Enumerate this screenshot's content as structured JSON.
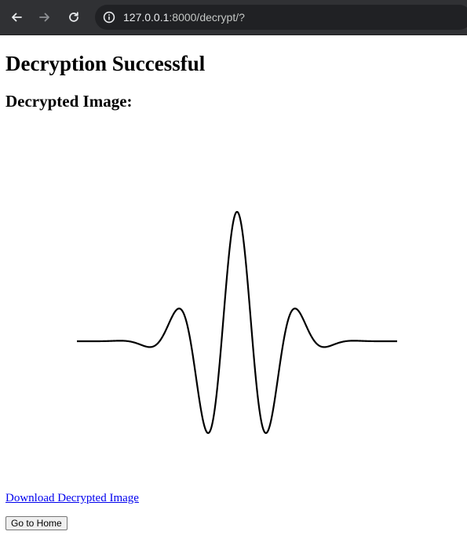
{
  "browser": {
    "url_host": "127.0.0.1",
    "url_rest": ":8000/decrypt/?",
    "icons": {
      "back": "back-arrow-icon",
      "forward": "forward-arrow-icon",
      "reload": "reload-icon",
      "site_info": "info-icon"
    },
    "colors": {
      "toolbar": "#303134",
      "omnibox": "#202124"
    }
  },
  "page": {
    "title": "Decryption Successful",
    "subtitle": "Decrypted Image:",
    "download_link": "Download Decrypted Image",
    "home_button": "Go to Home"
  },
  "decrypted_image": {
    "content": "wavelet-line-drawing",
    "stroke_color": "#000000"
  }
}
